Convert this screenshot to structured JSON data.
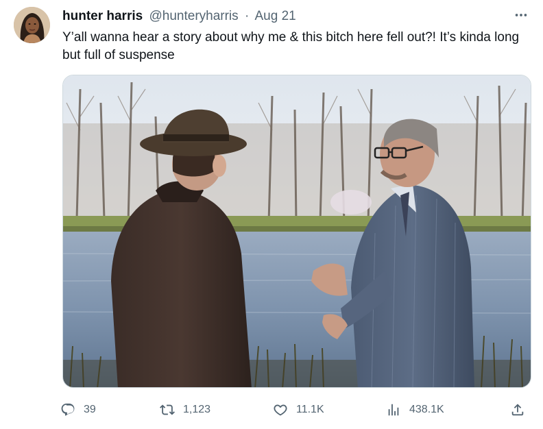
{
  "tweet": {
    "display_name": "hunter harris",
    "handle": "@hunteryharris",
    "separator": "·",
    "date": "Aug 21",
    "text": "Y’all wanna hear a story about why me & this bitch here fell out?! It’s kinda long but full of suspense",
    "more_icon": "more-horizontal-icon",
    "avatar_icon": "avatar"
  },
  "media": {
    "alt": "Two men in 1940s suits talking beside a lake in early spring"
  },
  "actions": {
    "reply": {
      "icon": "reply-icon",
      "count": "39"
    },
    "retweet": {
      "icon": "retweet-icon",
      "count": "1,123"
    },
    "like": {
      "icon": "heart-icon",
      "count": "11.1K"
    },
    "views": {
      "icon": "views-icon",
      "count": "438.1K"
    },
    "share": {
      "icon": "share-icon"
    }
  },
  "colors": {
    "text_primary": "#0f1419",
    "text_secondary": "#536471",
    "border": "#cfd9de"
  }
}
